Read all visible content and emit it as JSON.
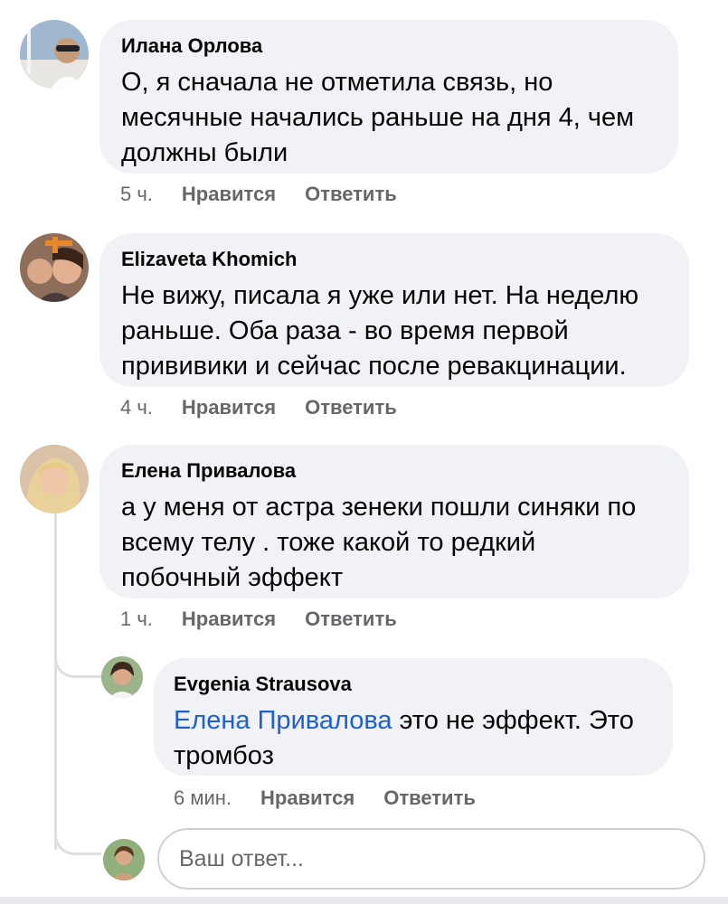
{
  "comments": [
    {
      "author": "Илана Орлова",
      "lines": [
        "О, я сначала не отметила связь, но",
        "месячные начались раньше на дня 4, чем",
        "должны были"
      ],
      "time": "5 ч.",
      "like": "Нравится",
      "reply": "Ответить"
    },
    {
      "author": "Elizaveta Khomich",
      "lines": [
        "Не вижу, писала я уже или нет. На неделю",
        "раньше. Оба раза - во время первой",
        "прививики и сейчас после ревакцинации."
      ],
      "time": "4 ч.",
      "like": "Нравится",
      "reply": "Ответить"
    },
    {
      "author": "Елена Привалова",
      "lines": [
        "а у меня от астра зенеки пошли синяки по",
        "всему телу . тоже какой то редкий",
        "побочный эффект"
      ],
      "time": "1 ч.",
      "like": "Нравится",
      "reply": "Ответить"
    }
  ],
  "reply": {
    "author": "Evgenia Strausova",
    "mention": "Елена Привалова",
    "line1_rest": " это не эффект. Это",
    "line2": "тромбоз",
    "time": "6 мин.",
    "like": "Нравится",
    "reply": "Ответить"
  },
  "reply_box": {
    "placeholder": "Ваш ответ..."
  },
  "colors": {
    "bubble": "#f0f2f5",
    "meta": "#65676b",
    "mention": "#1f5fd6"
  }
}
